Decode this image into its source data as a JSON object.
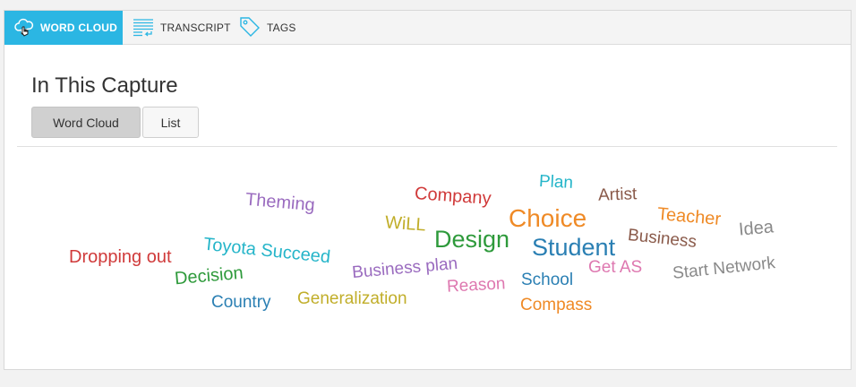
{
  "tabs": {
    "word_cloud": "WORD CLOUD",
    "transcript": "TRANSCRIPT",
    "tags": "TAGS"
  },
  "page_title": "In This Capture",
  "view_toggle": {
    "word_cloud": "Word Cloud",
    "list": "List",
    "selected": "Word Cloud"
  },
  "colors": {
    "accent": "#2bb6e3",
    "red": "#d03a3a",
    "purple": "#9a6bbf",
    "teal": "#25b5c9",
    "green": "#2e9a3b",
    "blue": "#2a7fb3",
    "olive": "#c1ae2a",
    "orange": "#ef8a26",
    "brown": "#8a5a4a",
    "gray": "#8a8a8a",
    "pink": "#de78b0"
  },
  "word_cloud": {
    "words": [
      {
        "text": "Theming",
        "color": "purple"
      },
      {
        "text": "Company",
        "color": "red"
      },
      {
        "text": "Plan",
        "color": "teal"
      },
      {
        "text": "Artist",
        "color": "brown"
      },
      {
        "text": "Teacher",
        "color": "orange"
      },
      {
        "text": "Idea",
        "color": "gray"
      },
      {
        "text": "WiLL",
        "color": "olive"
      },
      {
        "text": "Design",
        "color": "green"
      },
      {
        "text": "Choice",
        "color": "orange"
      },
      {
        "text": "Student",
        "color": "blue"
      },
      {
        "text": "Business",
        "color": "brown"
      },
      {
        "text": "Toyota Succeed",
        "color": "teal"
      },
      {
        "text": "Dropping out",
        "color": "red"
      },
      {
        "text": "Business plan",
        "color": "purple"
      },
      {
        "text": "Start Network",
        "color": "gray"
      },
      {
        "text": "Get AS",
        "color": "pink"
      },
      {
        "text": "Decision",
        "color": "green"
      },
      {
        "text": "School",
        "color": "blue"
      },
      {
        "text": "Reason",
        "color": "pink"
      },
      {
        "text": "Country",
        "color": "blue"
      },
      {
        "text": "Generalization",
        "color": "olive"
      },
      {
        "text": "Compass",
        "color": "orange"
      }
    ]
  }
}
